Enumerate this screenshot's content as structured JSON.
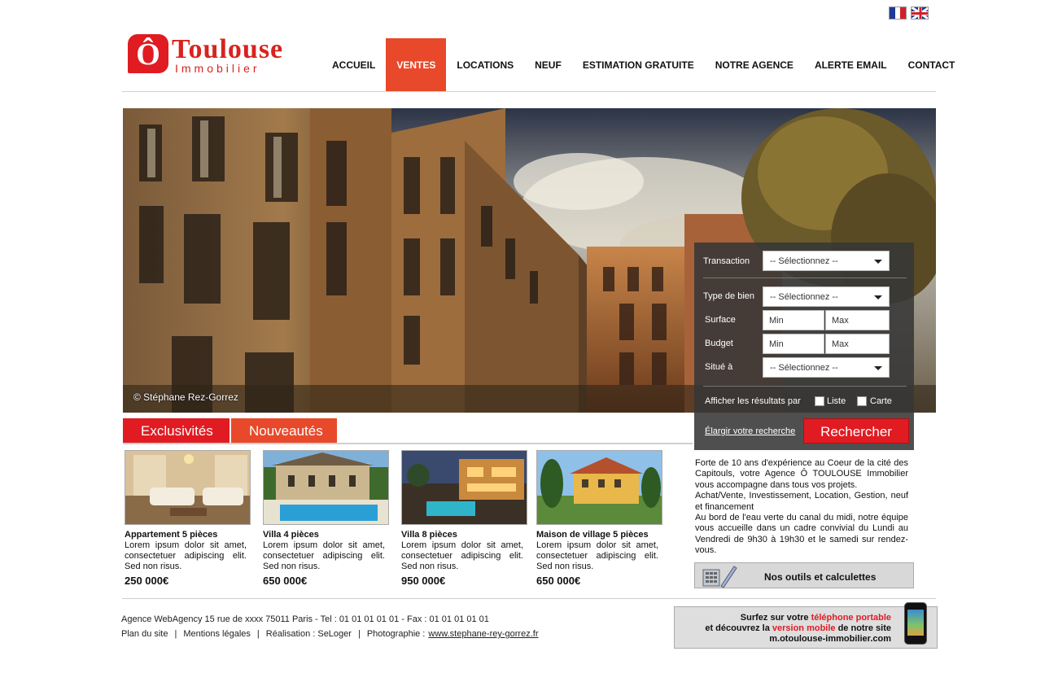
{
  "languages": [
    "fr",
    "en"
  ],
  "logo": {
    "mark": "Ô",
    "name": "Toulouse",
    "sub": "Immobilier"
  },
  "nav": {
    "items": [
      "ACCUEIL",
      "VENTES",
      "LOCATIONS",
      "NEUF",
      "ESTIMATION GRATUITE",
      "NOTRE AGENCE",
      "ALERTE EMAIL",
      "CONTACT"
    ],
    "active": "VENTES"
  },
  "hero": {
    "credit": "© Stéphane Rez-Gorrez"
  },
  "search": {
    "transaction_label": "Transaction",
    "transaction_value": "-- Sélectionnez --",
    "type_label": "Type de bien",
    "type_value": "-- Sélectionnez --",
    "surface_label": "Surface",
    "surface_min": "Min",
    "surface_max": "Max",
    "budget_label": "Budget",
    "budget_min": "Min",
    "budget_max": "Max",
    "location_label": "Situé à",
    "location_value": "-- Sélectionnez --",
    "display_label": "Afficher les résultats par",
    "option_list": "Liste",
    "option_map": "Carte",
    "expand_link": "Élargir votre recherche",
    "submit": "Rechercher"
  },
  "tabs": [
    "Exclusivités",
    "Nouveautés"
  ],
  "listings": [
    {
      "title": "Appartement 5 pièces",
      "desc": "Lorem ipsum dolor sit amet, consectetuer adipiscing elit. Sed non risus.",
      "price": "250 000€"
    },
    {
      "title": "Villa 4 pièces",
      "desc": "Lorem ipsum dolor sit amet, consectetuer adipiscing elit. Sed non risus.",
      "price": "650 000€"
    },
    {
      "title": "Villa 8 pièces",
      "desc": "Lorem ipsum dolor sit amet, consectetuer adipiscing elit. Sed non risus.",
      "price": "950 000€"
    },
    {
      "title": "Maison de village 5 pièces",
      "desc": "Lorem ipsum dolor sit amet, consectetuer adipiscing elit. Sed non risus.",
      "price": "650 000€"
    }
  ],
  "agency_text": {
    "p1": "Forte de 10 ans d'expérience au Coeur de la cité des Capitouls, votre Agence Ô TOULOUSE Immobilier vous accompagne dans tous vos projets.",
    "p2": "Achat/Vente, Investissement, Location, Gestion, neuf et financement",
    "p3": "Au bord de l'eau verte du canal du midi, notre équipe vous accueille dans un cadre convivial du Lundi au Vendredi de 9h30 à 19h30 et le samedi sur rendez-vous."
  },
  "tools_button": "Nos outils et calculettes",
  "footer": {
    "address": "Agence WebAgency 15 rue de xxxx  75011 Paris - Tel : 01 01 01 01 01  - Fax : 01 01 01 01 01",
    "links": [
      "Plan du site",
      "|",
      "Mentions légales",
      "|",
      "Réalisation : SeLoger",
      "|",
      "Photographie :"
    ],
    "photo_link": "www.stephane-rey-gorrez.fr"
  },
  "mobile": {
    "line1_a": "Surfez sur votre ",
    "line1_b": "téléphone portable",
    "line2_a": "et découvrez la ",
    "line2_b": "version mobile",
    "line2_c": " de notre site",
    "line3": "m.otoulouse-immobilier.com"
  },
  "colors": {
    "brand_red": "#e11b22",
    "accent_orange": "#e8492a"
  }
}
